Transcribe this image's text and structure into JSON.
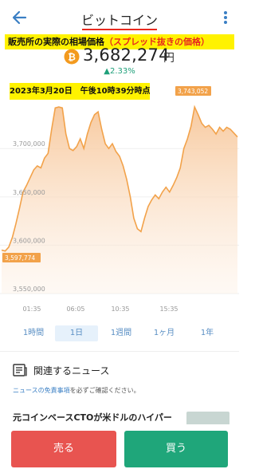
{
  "header": {
    "title": "ビットコイン"
  },
  "banner": {
    "label": "販売所の実際の相場価格",
    "note": "（スプレッド抜きの価格）"
  },
  "price": {
    "value": "3,682,274",
    "unit": "円",
    "change": "▲2.33%"
  },
  "date_banner": "2023年3月20日　午後10時39分時点",
  "chart_data": {
    "type": "area",
    "x_ticks": [
      "01:35",
      "06:05",
      "10:35",
      "15:35"
    ],
    "y_ticks": [
      "3,700,000",
      "3,650,000",
      "3,600,000",
      "3,550,000"
    ],
    "ylim": [
      3550000,
      3753000
    ],
    "max_label": "3,743,052",
    "min_label": "3,597,774",
    "values": [
      3595000,
      3594000,
      3598000,
      3608000,
      3622000,
      3638000,
      3655000,
      3662000,
      3670000,
      3678000,
      3682000,
      3680000,
      3690000,
      3695000,
      3720000,
      3742000,
      3743000,
      3742000,
      3715000,
      3700000,
      3698000,
      3702000,
      3710000,
      3700000,
      3715000,
      3727000,
      3735000,
      3738000,
      3720000,
      3705000,
      3700000,
      3705000,
      3697000,
      3692000,
      3682000,
      3668000,
      3650000,
      3628000,
      3617000,
      3614000,
      3628000,
      3640000,
      3647000,
      3652000,
      3648000,
      3655000,
      3660000,
      3655000,
      3662000,
      3670000,
      3680000,
      3700000,
      3710000,
      3723000,
      3743000,
      3735000,
      3726000,
      3722000,
      3724000,
      3720000,
      3715000,
      3722000,
      3718000,
      3722000,
      3720000,
      3716000,
      3712000
    ],
    "line_color": "#f2a24a",
    "fill_color": "#f7c79a"
  },
  "range_tabs": [
    "1時間",
    "1日",
    "1週間",
    "1ヶ月",
    "1年"
  ],
  "range_selected": "1日",
  "news": {
    "heading": "関連するニュース",
    "disclaimer_link": "ニュースの免責事項",
    "disclaimer_rest": "を必ずご確認ください。",
    "article_title": "元コインベースCTOが米ドルのハイパー"
  },
  "actions": {
    "sell": "売る",
    "buy": "買う"
  },
  "colors": {
    "accent_green": "#1fa07a",
    "sell_red": "#e85450",
    "buy_green": "#1fa67a",
    "highlight_yellow": "#fff200",
    "title_underline": "#e8281e"
  }
}
